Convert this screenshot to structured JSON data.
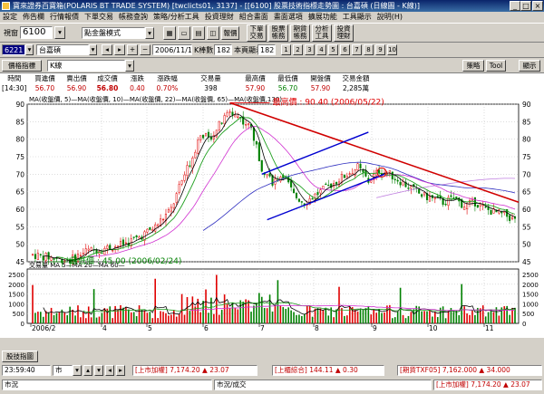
{
  "window": {
    "title": "寶來證券百寶箱(POLARIS BT TRADE SYSTEM)  [twclicts01, 3137] - [[6100] 股票技術指標走勢圖 : 台嘉碩 (日線圖 - K線)]"
  },
  "menu": [
    "設定",
    "佈告欄",
    "行情報價",
    "下單交易",
    "帳務查詢",
    "策略/分析工具",
    "投資理財",
    "組合畫面",
    "畫面選項",
    "擴展功能",
    "工具顯示",
    "說明(H)"
  ],
  "toolbar": {
    "view_label": "視窗",
    "stock_code": "6100",
    "mode_select": "點金盤模式",
    "buttons": {
      "report": "報價",
      "order": "下單\n交易",
      "account": "股票\n帳務",
      "futures": "期貨\n帳務",
      "analysis": "分析\n工具",
      "invest": "投資\n理財"
    }
  },
  "chart_controls": {
    "stock_field": "6221",
    "name_field": "台嘉碩",
    "date_field": "2006/11/10",
    "kcount_label": "K棒數目",
    "kcount_value": "182",
    "display_label": "本頁顯示",
    "display_value": "182",
    "number_buttons": [
      "1",
      "2",
      "3",
      "4",
      "5",
      "6",
      "7",
      "8",
      "9",
      "10"
    ],
    "indicator_button": "價格指標",
    "kline_select": "K線",
    "strategy_button": "策略",
    "tool_button": "Tool",
    "show_button": "顯示"
  },
  "quote": {
    "headers": [
      "時間",
      "買進價",
      "賣出價",
      "成交價",
      "漲跌",
      "漲跌幅",
      "交易量",
      "最高價",
      "最低價",
      "開盤價",
      "交易金額"
    ],
    "values": [
      "[14:30]",
      "56.70",
      "56.90",
      "56.80",
      "0.40",
      "0.70%",
      "398",
      "57.90",
      "56.70",
      "57.90",
      "2,285萬"
    ]
  },
  "chart_data": {
    "type": "candlestick",
    "ma_legend": "MA(收盤價, 5)—MA(收盤價, 10)—MA(收盤價, 22)—MA(收盤價, 65)—MA(收盤價,130)—",
    "volume_legend": "交易量 MA  5—MA 20—MA 60—",
    "highest_label": "最高價 : 90.40 (2006/05/22)",
    "lowest_label": "最低價 : 45.00 (2006/02/24)",
    "ylim": [
      45,
      90
    ],
    "yticks": [
      45,
      50,
      55,
      60,
      65,
      70,
      75,
      80,
      85,
      90
    ],
    "vol_ticks": [
      0,
      500,
      1000,
      1500,
      2000,
      2500
    ],
    "vol_ylim": [
      0,
      2500
    ],
    "xlabels": [
      "2006/2",
      "4",
      "5",
      "6",
      "7",
      "8",
      "9",
      "10",
      "11"
    ],
    "colors": {
      "up": "#e00000",
      "down": "#008000",
      "ma5": "#000000",
      "ma10": "#20a020",
      "ma22": "#d030d0",
      "ma65": "#3030c0",
      "ma130": "#c080e0",
      "trend_down": "#d00000",
      "channel": "#0000d0"
    }
  },
  "status": {
    "tab_label": "股技指圖",
    "time": "23:59:40",
    "market_label": "市",
    "tickers": [
      {
        "name": "[上市加權]",
        "value": "7,174.20",
        "change": "▲ 23.07"
      },
      {
        "name": "[上櫃綜合]",
        "value": "144.11",
        "change": "▲ 0.30"
      },
      {
        "name": "[期貨TXF05]",
        "value": "7,162.000",
        "change": "▲ 34.000"
      }
    ],
    "market_news": "市況",
    "market_news2": "市況/成交",
    "ticker2_name": "[上市加權]",
    "ticker2_value": "7,174.20",
    "ticker2_change": "▲ 23.07"
  }
}
